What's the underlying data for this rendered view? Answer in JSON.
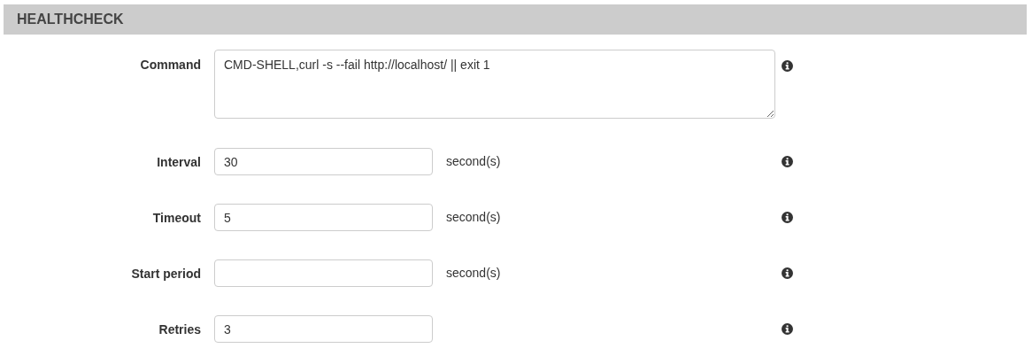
{
  "section": {
    "title": "HEALTHCHECK"
  },
  "fields": [
    {
      "kind": "textarea",
      "label": "Command",
      "value": "CMD-SHELL,curl -s --fail http://localhost/ || exit 1"
    },
    {
      "kind": "input",
      "label": "Interval",
      "value": "30",
      "unit": "second(s)"
    },
    {
      "kind": "input",
      "label": "Timeout",
      "value": "5",
      "unit": "second(s)"
    },
    {
      "kind": "input",
      "label": "Start period",
      "unit": "second(s)"
    },
    {
      "kind": "input",
      "label": "Retries",
      "value": "3"
    }
  ]
}
